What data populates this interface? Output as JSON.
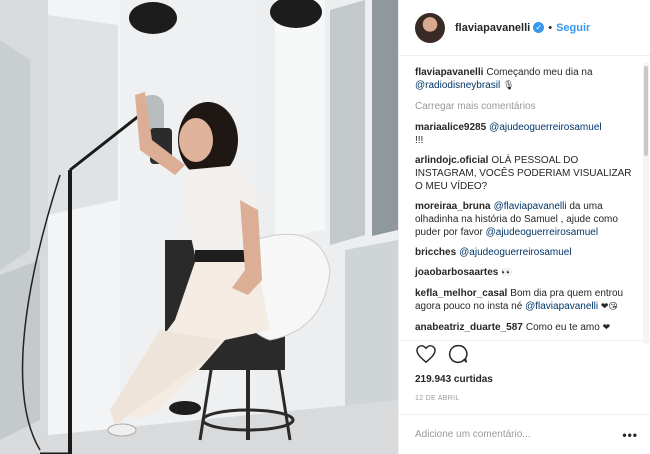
{
  "photo": {
    "alt": "Studio photo of a singer at a microphone"
  },
  "header": {
    "username": "flaviapavanelli",
    "verified_symbol": "✓",
    "separator": "•",
    "follow_label": "Seguir"
  },
  "caption": {
    "username": "flaviapavanelli",
    "text": "Começando meu dia na",
    "mention": "@radiodisneybrasil",
    "emoji": "🎙"
  },
  "load_more": "Carregar mais comentários",
  "comments": [
    {
      "user": "mariaalice9285",
      "mention": "@ajudeoguerreirosamuel",
      "text": "!!!"
    },
    {
      "user": "arlindojc.oficial",
      "text": "OLÁ PESSOAL DO INSTAGRAM, VOCÊS PODERIAM VISUALIZAR O MEU VÍDEO?"
    },
    {
      "user": "moreiraa_bruna",
      "mention": "@flaviapavanelli",
      "text": "da uma olhadinha na história do Samuel , ajude como puder por favor",
      "mention2": "@ajudeoguerreirosamuel"
    },
    {
      "user": "bricches",
      "mention": "@ajudeoguerreirosamuel"
    },
    {
      "user": "joaobarbosaartes",
      "emoji": "👀"
    },
    {
      "user": "kefla_melhor_casal",
      "text": "Bom dia pra quem entrou agora pouco no insta né",
      "mention": "@flaviapavanelli",
      "emoji": "❤😘"
    },
    {
      "user": "anabeatriz_duarte_587",
      "text": "Como eu te amo",
      "emoji": "❤"
    }
  ],
  "actions": {
    "like_icon": "heart-icon",
    "comment_icon": "comment-icon"
  },
  "likes": "219.943 curtidas",
  "date": "12 DE ABRIL",
  "add_comment": {
    "placeholder": "Adicione um comentário...",
    "more_label": "•••"
  },
  "colors": {
    "link": "#3897f0",
    "mention": "#003569",
    "muted": "#999999",
    "text": "#262626"
  }
}
